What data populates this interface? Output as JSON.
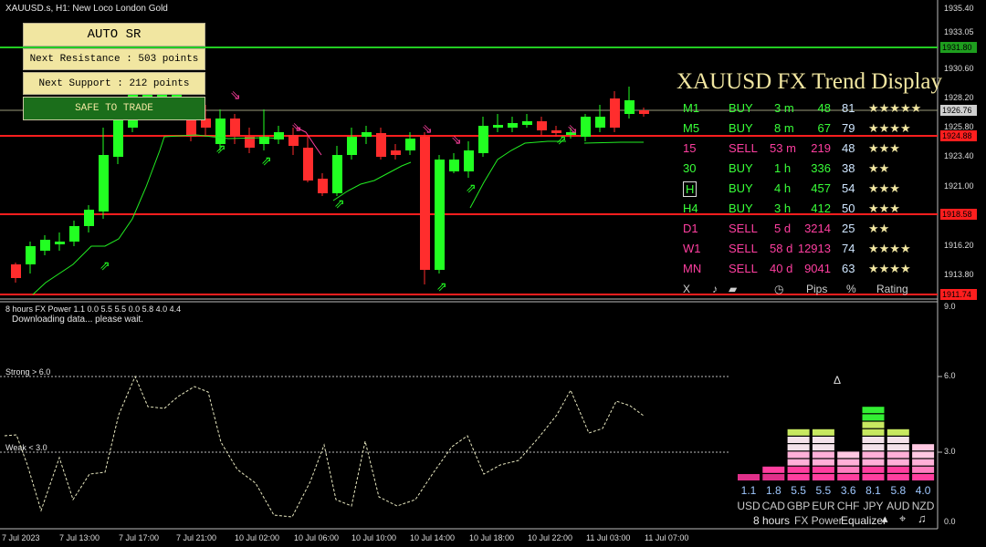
{
  "window": {
    "title": "XAUUSD.s, H1:  New Loco London Gold"
  },
  "panel": {
    "auto_sr_label": "AUTO SR",
    "resistance_label": "Next Resistance : 503 points",
    "support_label": "Next Support : 212 points",
    "safe_label": "SAFE TO TRADE"
  },
  "price_axis": {
    "labels": [
      "1935.40",
      "1933.05",
      "1930.60",
      "1928.20",
      "1925.80",
      "1923.40",
      "1921.00",
      "1916.20",
      "1913.80"
    ],
    "current_price": "1926.76",
    "resistance_price": "1931.80",
    "red_line_1_price": "1924.88",
    "red_line_2_price": "1918.58",
    "red_line_3_price": "1911.74"
  },
  "trend_display": {
    "title": "XAUUSD FX Trend Display",
    "rows": [
      {
        "tf": "M1",
        "sig": "BUY",
        "time": "3 m",
        "pips": "48",
        "pct": "81",
        "rating": "★★★★★",
        "color": "#39ff39"
      },
      {
        "tf": "M5",
        "sig": "BUY",
        "time": "8 m",
        "pips": "67",
        "pct": "79",
        "rating": "★★★★",
        "color": "#39ff39"
      },
      {
        "tf": "15",
        "sig": "SELL",
        "time": "53 m",
        "pips": "219",
        "pct": "48",
        "rating": "★★★",
        "color": "#ff3fa0"
      },
      {
        "tf": "30",
        "sig": "BUY",
        "time": "1 h",
        "pips": "336",
        "pct": "38",
        "rating": "★★",
        "color": "#39ff39"
      },
      {
        "tf": "H",
        "sig": "BUY",
        "time": "4 h",
        "pips": "457",
        "pct": "54",
        "rating": "★★★",
        "color": "#39ff39"
      },
      {
        "tf": "H4",
        "sig": "BUY",
        "time": "3 h",
        "pips": "412",
        "pct": "50",
        "rating": "★★★",
        "color": "#39ff39"
      },
      {
        "tf": "D1",
        "sig": "SELL",
        "time": "5 d",
        "pips": "3214",
        "pct": "25",
        "rating": "★★",
        "color": "#ff3fa0"
      },
      {
        "tf": "W1",
        "sig": "SELL",
        "time": "58 d",
        "pips": "12913",
        "pct": "74",
        "rating": "★★★★",
        "color": "#ff3fa0"
      },
      {
        "tf": "MN",
        "sig": "SELL",
        "time": "40 d",
        "pips": "9041",
        "pct": "63",
        "rating": "★★★★",
        "color": "#ff3fa0"
      }
    ],
    "footer": {
      "close": "X",
      "pips": "Pips",
      "pct": "%",
      "rating": "Rating"
    }
  },
  "sub_window": {
    "title": "8 hours FX Power 1.1 0.0 5.5 5.5 0.0 5.8 4.0 4.4",
    "status": "Downloading data... please wait.",
    "strong_label": "Strong > 6.0",
    "weak_label": "Weak < 3.0",
    "axis_labels": [
      "9.0",
      "6.0",
      "3.0",
      "0.0"
    ],
    "delta_symbol": "Δ"
  },
  "equalizer": {
    "currencies": [
      {
        "code": "USD",
        "value": "1.1",
        "level": 1.1
      },
      {
        "code": "CAD",
        "value": "1.8",
        "level": 1.8
      },
      {
        "code": "GBP",
        "value": "5.5",
        "level": 5.5
      },
      {
        "code": "EUR",
        "value": "5.5",
        "level": 5.5
      },
      {
        "code": "CHF",
        "value": "3.6",
        "level": 3.6
      },
      {
        "code": "JPY",
        "value": "8.1",
        "level": 8.1
      },
      {
        "code": "AUD",
        "value": "5.8",
        "level": 5.8
      },
      {
        "code": "NZD",
        "value": "4.0",
        "level": 4.0
      }
    ],
    "period": "8 hours",
    "name": "FX Power",
    "mode": "Equalizer"
  },
  "time_axis": [
    "7 Jul 2023",
    "7 Jul 13:00",
    "7 Jul 17:00",
    "7 Jul 21:00",
    "10 Jul 02:00",
    "10 Jul 06:00",
    "10 Jul 10:00",
    "10 Jul 14:00",
    "10 Jul 18:00",
    "10 Jul 22:00",
    "11 Jul 03:00",
    "11 Jul 07:00"
  ],
  "colors": {
    "bull": "#22ff22",
    "bear": "#ff2d2d",
    "line": "#e0e0e0",
    "resistance": "#22cc22",
    "support": "#ff1e1e",
    "accent": "#f1e6a1"
  }
}
